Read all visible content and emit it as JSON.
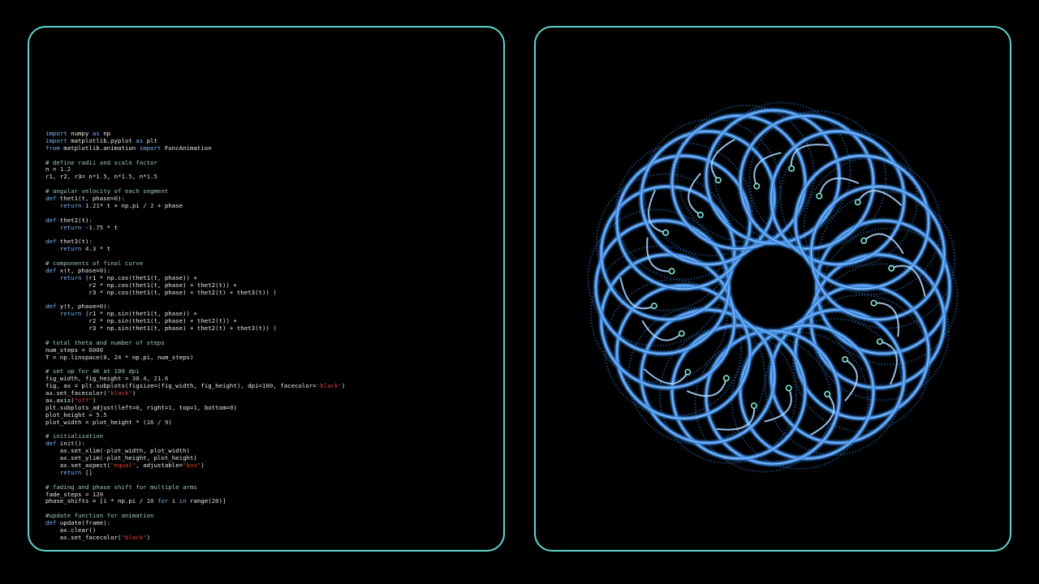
{
  "theme": {
    "background": "#000000",
    "panel_border": "#5ed6cf",
    "keyword": "#7ab7ff",
    "comment": "#9ec8c0",
    "string": "#e0453a",
    "curve": "#3a87e0",
    "curve_glow": "#a8d4ff",
    "marker": "#7fe8d8"
  },
  "code": {
    "lines": [
      [
        [
          "kw",
          "import"
        ],
        [
          "tx",
          " numpy "
        ],
        [
          "kw",
          "as"
        ],
        [
          "tx",
          " np"
        ]
      ],
      [
        [
          "kw",
          "import"
        ],
        [
          "tx",
          " matplotlib.pyplot "
        ],
        [
          "kw",
          "as"
        ],
        [
          "tx",
          " plt"
        ]
      ],
      [
        [
          "kw",
          "from"
        ],
        [
          "tx",
          " matplotlib.animation "
        ],
        [
          "kw",
          "import"
        ],
        [
          "tx",
          " FuncAnimation"
        ]
      ],
      [],
      [
        [
          "cm",
          "# define radii and scale factor"
        ]
      ],
      [
        [
          "tx",
          "n = "
        ],
        [
          "num",
          "1.2"
        ]
      ],
      [
        [
          "tx",
          "r1, r2, r3= n*"
        ],
        [
          "num",
          "1.5"
        ],
        [
          "tx",
          ", n*"
        ],
        [
          "num",
          "1.5"
        ],
        [
          "tx",
          ", n*"
        ],
        [
          "num",
          "1.5"
        ]
      ],
      [],
      [
        [
          "cm",
          "# angular velocity of each segment"
        ]
      ],
      [
        [
          "kw",
          "def"
        ],
        [
          "tx",
          " thet1(t, phase="
        ],
        [
          "num",
          "0"
        ],
        [
          "tx",
          "):"
        ]
      ],
      [
        [
          "tx",
          "    "
        ],
        [
          "kw",
          "return"
        ],
        [
          "tx",
          " "
        ],
        [
          "num",
          "1.21"
        ],
        [
          "tx",
          "* t + np.pi / "
        ],
        [
          "num",
          "2"
        ],
        [
          "tx",
          " + phase"
        ]
      ],
      [],
      [
        [
          "kw",
          "def"
        ],
        [
          "tx",
          " thet2(t):"
        ]
      ],
      [
        [
          "tx",
          "    "
        ],
        [
          "kw",
          "return"
        ],
        [
          "tx",
          " -"
        ],
        [
          "num",
          "1.75"
        ],
        [
          "tx",
          " * t"
        ]
      ],
      [],
      [
        [
          "kw",
          "def"
        ],
        [
          "tx",
          " thet3(t):"
        ]
      ],
      [
        [
          "tx",
          "    "
        ],
        [
          "kw",
          "return"
        ],
        [
          "tx",
          " "
        ],
        [
          "num",
          "4.3"
        ],
        [
          "tx",
          " * t"
        ]
      ],
      [],
      [
        [
          "cm",
          "# components of final curve"
        ]
      ],
      [
        [
          "kw",
          "def"
        ],
        [
          "tx",
          " x(t, phase="
        ],
        [
          "num",
          "0"
        ],
        [
          "tx",
          "):"
        ]
      ],
      [
        [
          "tx",
          "    "
        ],
        [
          "kw",
          "return"
        ],
        [
          "tx",
          " (r1 * np.cos(thet1(t, phase)) +"
        ]
      ],
      [
        [
          "tx",
          "            r2 * np.cos(thet1(t, phase) + thet2(t)) +"
        ]
      ],
      [
        [
          "tx",
          "            r3 * np.cos(thet1(t, phase) + thet2(t) + thet3(t)) )"
        ]
      ],
      [],
      [
        [
          "kw",
          "def"
        ],
        [
          "tx",
          " y(t, phase="
        ],
        [
          "num",
          "0"
        ],
        [
          "tx",
          "):"
        ]
      ],
      [
        [
          "tx",
          "    "
        ],
        [
          "kw",
          "return"
        ],
        [
          "tx",
          " (r1 * np.sin(thet1(t, phase)) +"
        ]
      ],
      [
        [
          "tx",
          "            r2 * np.sin(thet1(t, phase) + thet2(t)) +"
        ]
      ],
      [
        [
          "tx",
          "            r3 * np.sin(thet1(t, phase) + thet2(t) + thet3(t)) )"
        ]
      ],
      [],
      [
        [
          "cm",
          "# total theta and number of steps"
        ]
      ],
      [
        [
          "tx",
          "num_steps = "
        ],
        [
          "num",
          "6000"
        ]
      ],
      [
        [
          "tx",
          "T = np.linspace("
        ],
        [
          "num",
          "0"
        ],
        [
          "tx",
          ", "
        ],
        [
          "num",
          "24"
        ],
        [
          "tx",
          " * np.pi, num_steps)"
        ]
      ],
      [],
      [
        [
          "cm",
          "# set up for 4K at 100 dpi"
        ]
      ],
      [
        [
          "tx",
          "fig_width, fig_height = "
        ],
        [
          "num",
          "38.4"
        ],
        [
          "tx",
          ", "
        ],
        [
          "num",
          "21.6"
        ]
      ],
      [
        [
          "tx",
          "fig, ax = plt.subplots(figsize=(fig_width, fig_height), dpi="
        ],
        [
          "num",
          "100"
        ],
        [
          "tx",
          ", facecolor="
        ],
        [
          "str",
          "'black'"
        ],
        [
          "tx",
          ")"
        ]
      ],
      [
        [
          "tx",
          "ax.set_facecolor("
        ],
        [
          "str",
          "\"black\""
        ],
        [
          "tx",
          ")"
        ]
      ],
      [
        [
          "tx",
          "ax.axis("
        ],
        [
          "str",
          "\"off\""
        ],
        [
          "tx",
          ")"
        ]
      ],
      [
        [
          "tx",
          "plt.subplots_adjust(left="
        ],
        [
          "num",
          "0"
        ],
        [
          "tx",
          ", right="
        ],
        [
          "num",
          "1"
        ],
        [
          "tx",
          ", top="
        ],
        [
          "num",
          "1"
        ],
        [
          "tx",
          ", bottom="
        ],
        [
          "num",
          "0"
        ],
        [
          "tx",
          ")"
        ]
      ],
      [
        [
          "tx",
          "plot_height = "
        ],
        [
          "num",
          "5.5"
        ]
      ],
      [
        [
          "tx",
          "plot_width = plot_height * ("
        ],
        [
          "num",
          "16"
        ],
        [
          "tx",
          " / "
        ],
        [
          "num",
          "9"
        ],
        [
          "tx",
          ")"
        ]
      ],
      [],
      [
        [
          "cm",
          "# initialization"
        ]
      ],
      [
        [
          "kw",
          "def"
        ],
        [
          "tx",
          " init():"
        ]
      ],
      [
        [
          "tx",
          "    ax.set_xlim(-plot_width, plot_width)"
        ]
      ],
      [
        [
          "tx",
          "    ax.set_ylim(-plot_height, plot_height)"
        ]
      ],
      [
        [
          "tx",
          "    ax.set_aspect("
        ],
        [
          "str",
          "\"equal\""
        ],
        [
          "tx",
          ", adjustable="
        ],
        [
          "str",
          "\"box\""
        ],
        [
          "tx",
          ")"
        ]
      ],
      [
        [
          "tx",
          "    "
        ],
        [
          "kw",
          "return"
        ],
        [
          "tx",
          " []"
        ]
      ],
      [],
      [
        [
          "cm",
          "# fading and phase shift for multiple arms"
        ]
      ],
      [
        [
          "tx",
          "fade_steps = "
        ],
        [
          "num",
          "120"
        ]
      ],
      [
        [
          "tx",
          "phase_shifts = [i * np.pi / "
        ],
        [
          "num",
          "10"
        ],
        [
          "tx",
          " "
        ],
        [
          "kw",
          "for"
        ],
        [
          "tx",
          " i "
        ],
        [
          "kw",
          "in"
        ],
        [
          "tx",
          " range("
        ],
        [
          "num",
          "20"
        ],
        [
          "tx",
          ")]"
        ]
      ],
      [],
      [
        [
          "cm",
          "#update function for animation"
        ]
      ],
      [
        [
          "kw",
          "def"
        ],
        [
          "tx",
          " update(frame):"
        ]
      ],
      [
        [
          "tx",
          "    ax.clear()"
        ]
      ],
      [
        [
          "tx",
          "    ax.set_facecolor("
        ],
        [
          "str",
          "\"black\""
        ],
        [
          "tx",
          ")"
        ]
      ]
    ]
  },
  "visualization": {
    "type": "parametric-spirograph",
    "arms": 20,
    "ring_radius": 136,
    "loop_radius": 82,
    "head_radius_range": [
      96,
      172
    ]
  }
}
